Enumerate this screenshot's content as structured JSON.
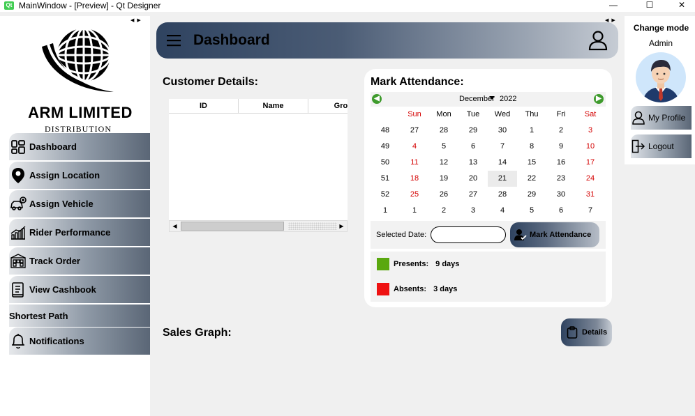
{
  "window": {
    "title": "MainWindow - [Preview] - Qt Designer",
    "app_icon": "qt-icon",
    "controls": {
      "minimize": "—",
      "maximize": "☐",
      "close": "✕"
    }
  },
  "logo": {
    "brand": "ARM LIMITED",
    "subtitle": "DISTRIBUTION COMPANY"
  },
  "sidebar": {
    "items": [
      {
        "label": "Dashboard",
        "icon": "dashboard-icon"
      },
      {
        "label": "Assign Location",
        "icon": "location-pin-icon"
      },
      {
        "label": "Assign Vehicle",
        "icon": "vehicle-icon"
      },
      {
        "label": "Rider Performance",
        "icon": "performance-icon"
      },
      {
        "label": "Track Order",
        "icon": "track-order-icon"
      },
      {
        "label": "View Cashbook",
        "icon": "cashbook-icon"
      },
      {
        "label": "Shortest Path",
        "icon": ""
      },
      {
        "label": "Notifications",
        "icon": "bell-icon"
      }
    ]
  },
  "header": {
    "title": "Dashboard",
    "menu_icon": "hamburger-icon",
    "user_icon": "user-icon"
  },
  "customer": {
    "title": "Customer Details:",
    "columns": [
      "ID",
      "Name",
      "Gros"
    ]
  },
  "attendance": {
    "title": "Mark Attendance:",
    "calendar": {
      "month": "December",
      "year": "2022",
      "weekdays": [
        "Sun",
        "Mon",
        "Tue",
        "Wed",
        "Thu",
        "Fri",
        "Sat"
      ],
      "weeks": [
        {
          "num": "48",
          "days": [
            "27",
            "28",
            "29",
            "30",
            "1",
            "2",
            "3"
          ]
        },
        {
          "num": "49",
          "days": [
            "4",
            "5",
            "6",
            "7",
            "8",
            "9",
            "10"
          ]
        },
        {
          "num": "50",
          "days": [
            "11",
            "12",
            "13",
            "14",
            "15",
            "16",
            "17"
          ]
        },
        {
          "num": "51",
          "days": [
            "18",
            "19",
            "20",
            "21",
            "22",
            "23",
            "24"
          ]
        },
        {
          "num": "52",
          "days": [
            "25",
            "26",
            "27",
            "28",
            "29",
            "30",
            "31"
          ]
        },
        {
          "num": "1",
          "days": [
            "1",
            "2",
            "3",
            "4",
            "5",
            "6",
            "7"
          ]
        }
      ],
      "selected_day": "21",
      "weekend_color": "#d40000",
      "nav_color": "#3f9b2d"
    },
    "selected_date_label": "Selected Date:",
    "selected_date_value": "",
    "mark_button": "Mark Attendance",
    "presents_label": "Presents:",
    "presents_value": "9 days",
    "presents_color": "#5aa80f",
    "absents_label": "Absents:",
    "absents_value": "3 days",
    "absents_color": "#ee1111"
  },
  "sales": {
    "title": "Sales Graph:",
    "details_button": "Details"
  },
  "right_panel": {
    "change_mode": "Change mode",
    "role": "Admin",
    "my_profile": "My Profile",
    "logout": "Logout"
  }
}
